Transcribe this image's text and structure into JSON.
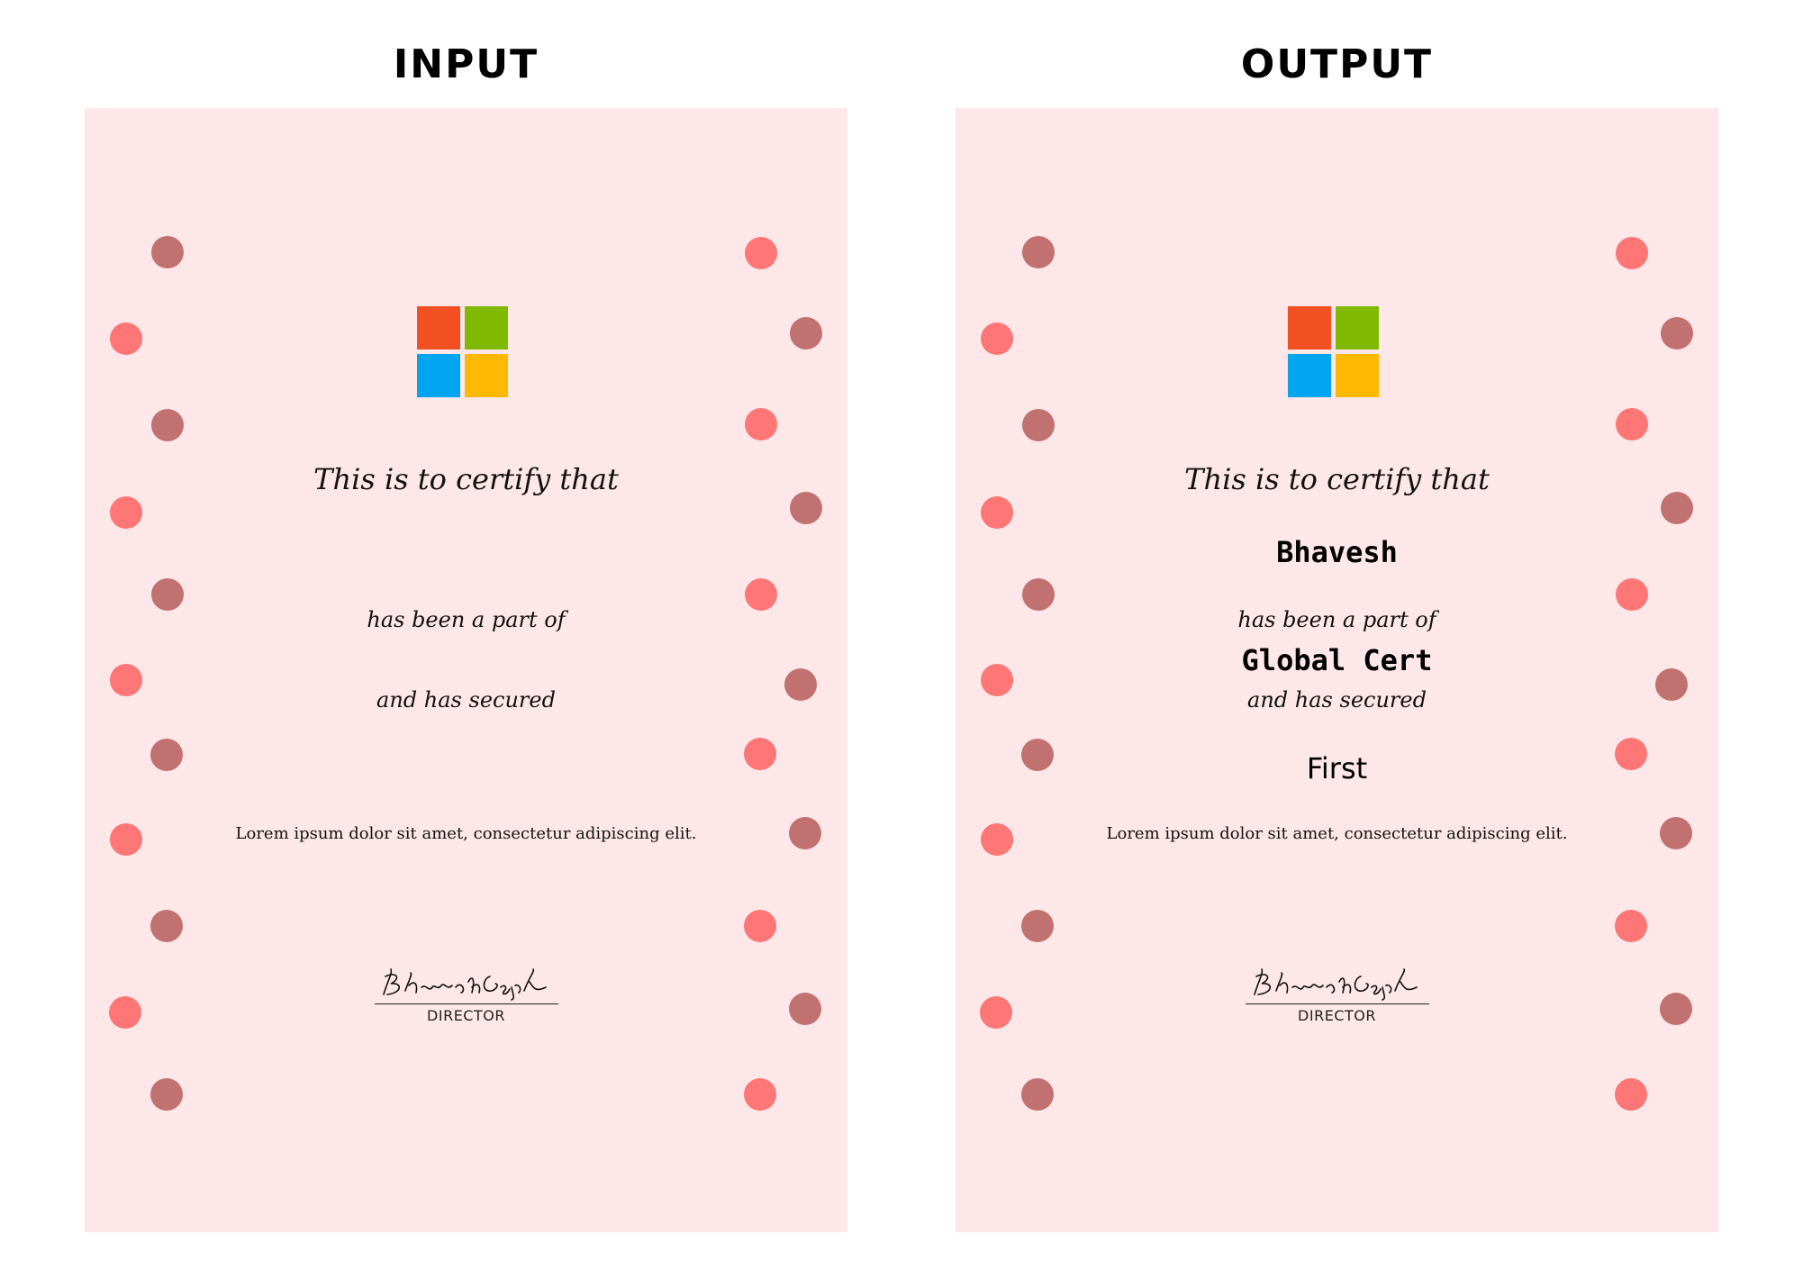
{
  "panels": [
    {
      "title": "INPUT",
      "certify_text": "This is to certify that",
      "part_text": "has been a part of",
      "secured_text": "and has secured",
      "lorem_text": "Lorem ipsum dolor sit amet, consectetur adipiscing elit.",
      "signature_text": "Bhavesh Goyal",
      "director_label": "DIRECTOR",
      "recipient_name": "",
      "event_name": "",
      "rank": ""
    },
    {
      "title": "OUTPUT",
      "certify_text": "This is to certify that",
      "part_text": "has been a part of",
      "secured_text": "and has secured",
      "lorem_text": "Lorem ipsum dolor sit amet, consectetur adipiscing elit.",
      "signature_text": "Bhavesh Goyal",
      "director_label": "DIRECTOR",
      "recipient_name": "Bhavesh",
      "event_name": "Global Cert",
      "rank": "First"
    }
  ],
  "colors": {
    "certificate_background": "#fde7e8",
    "dot_dark": "#c27171",
    "dot_light": "#ff7676",
    "logo_red": "#f25022",
    "logo_green": "#7fba00",
    "logo_blue": "#00a4ef",
    "logo_yellow": "#ffb900"
  },
  "icons": {
    "logo": "microsoft-logo-icon",
    "decoration": "polka-dot-icon"
  }
}
